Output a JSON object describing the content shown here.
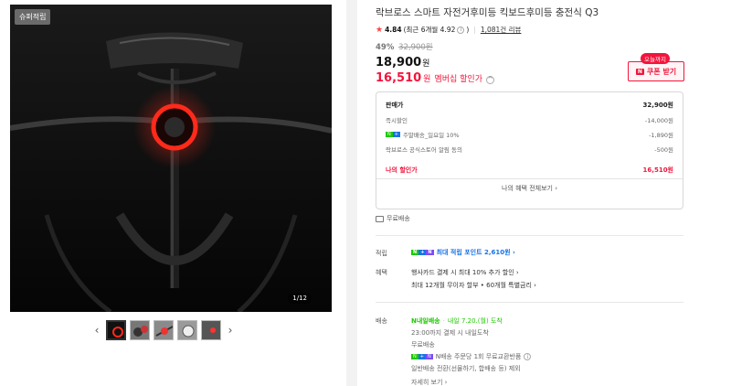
{
  "gallery": {
    "badge": "슈퍼적립",
    "counter": "1/12",
    "prev_arrow": "‹",
    "next_arrow": "›"
  },
  "product": {
    "title": "락브로스 스마트 자전거후미등 킥보드후미등 충전식 Q3",
    "rating_star": "★",
    "rating": "4.84",
    "rating_recent": "(최근 6개월 4.92",
    "rating_recent_close": ")",
    "review_link": "1,081건 리뷰",
    "discount_pct": "49%",
    "original_price": "32,900원",
    "price": "18,900",
    "price_unit": "원",
    "member_price": "16,510",
    "member_unit": "원",
    "member_label": "멤버십 할인가",
    "member_chevron": "^"
  },
  "coupon": {
    "today_tag": "오늘까지",
    "n_mark": "N",
    "label": "쿠폰 받기"
  },
  "breakdown": {
    "rows": [
      {
        "label": "판매가",
        "value": "32,900원"
      },
      {
        "label": "즉시할인",
        "value": "-14,000원"
      },
      {
        "label": "주말배송_일요일 10%",
        "value": "-1,890원"
      },
      {
        "label": "락브로스 공식스토어 알림 동의",
        "value": "-500원"
      }
    ],
    "mine_label": "나의 할인가",
    "mine_value": "16,510원",
    "all_benefits": "나의 혜택 전체보기 ›"
  },
  "np_badge": {
    "n": "N",
    "p": "+"
  },
  "shipping_free": "무료배송",
  "points": {
    "label": "적립",
    "text": "최대 적립 포인트 2,610원 ›"
  },
  "benefits": {
    "label": "혜택",
    "line1": "행사카드 결제 시 최대 10% 추가 할인 ›",
    "line2": "최대 12개월 무이자 할부 • 60개월 특별금리 ›"
  },
  "delivery": {
    "label": "배송",
    "badge": "N내일배송",
    "date": "내일 7.20.(월) 도착",
    "cutoff": "23:00까지 결제 시 내일도착",
    "free": "무료배송",
    "exchange": "N배송 주문당 1회 무료교환반품",
    "normal": "일반배송 전환(선물하기, 합배송 등) 제외",
    "more": "자세히 보기 ›"
  },
  "colors": {
    "accent_red": "#f2153c",
    "naver_green": "#1ec800",
    "link_blue": "#1a73e8"
  }
}
